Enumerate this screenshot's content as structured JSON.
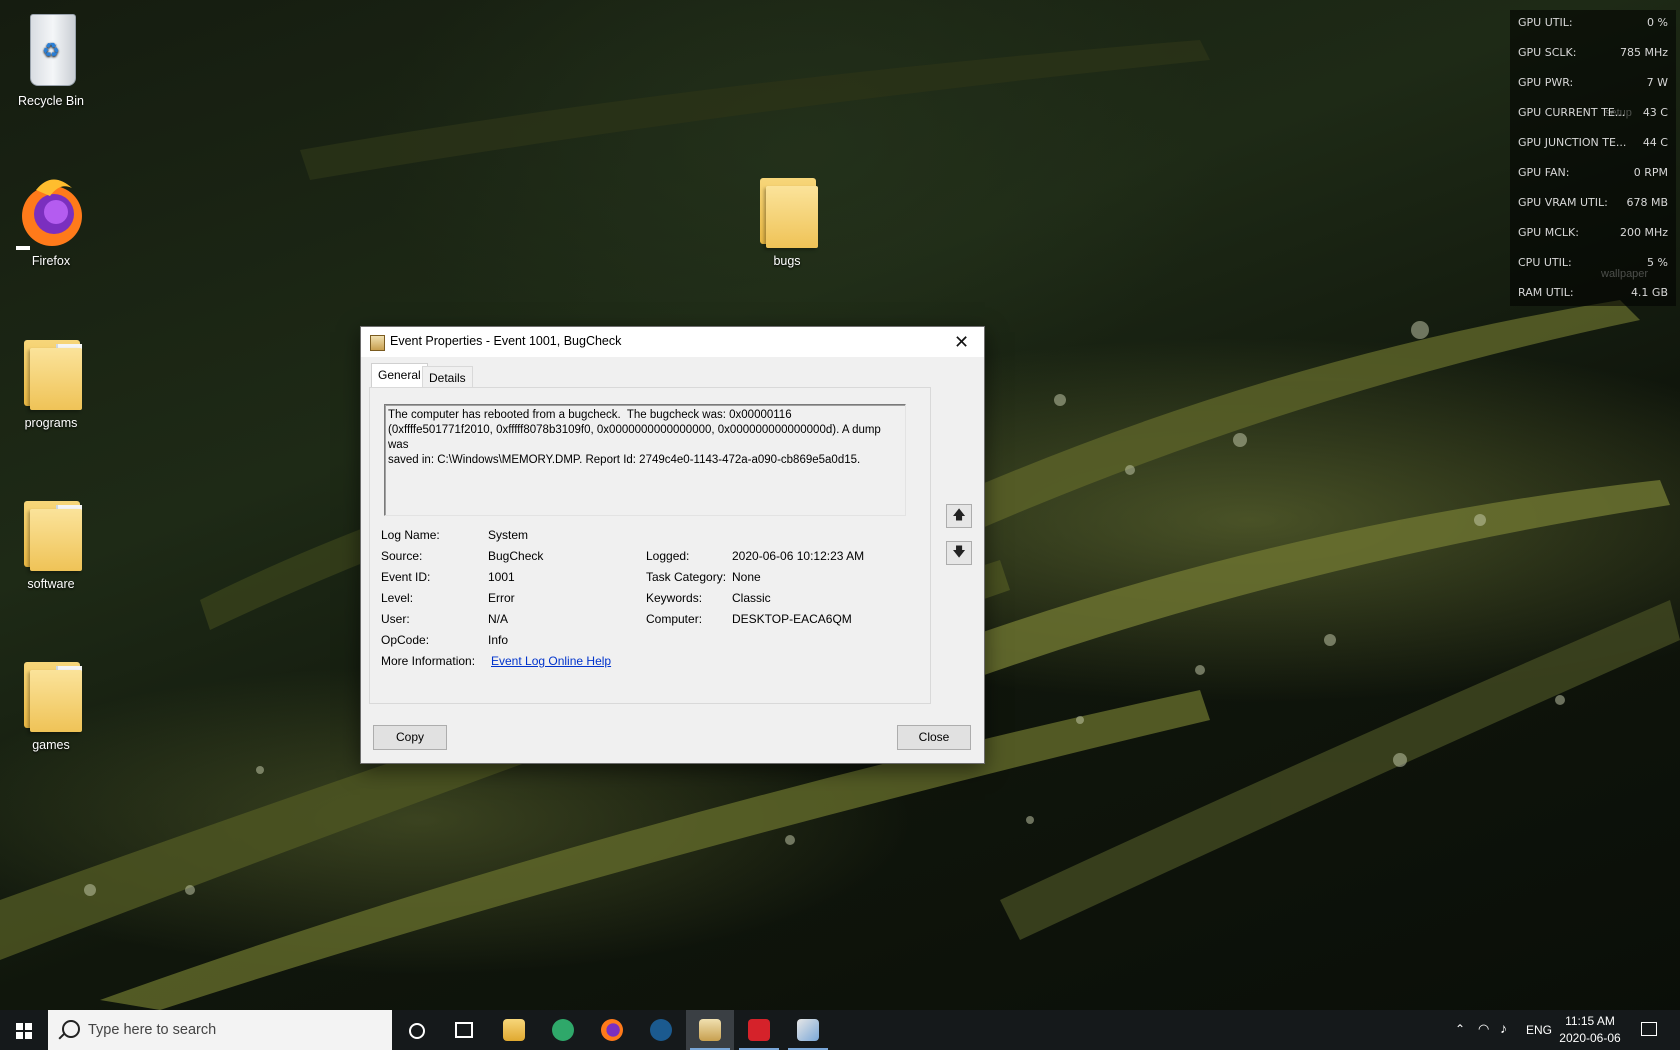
{
  "desktop": {
    "icons": [
      {
        "label": "Recycle Bin"
      },
      {
        "label": "Firefox"
      },
      {
        "label": "programs"
      },
      {
        "label": "software"
      },
      {
        "label": "games"
      },
      {
        "label": "bugs"
      }
    ],
    "overlay_ghost_labels": {
      "setup": "setup",
      "wallpaper": "wallpaper"
    }
  },
  "gpu_overlay": {
    "rows": [
      {
        "label": "GPU UTIL:",
        "value": "0 %"
      },
      {
        "label": "GPU SCLK:",
        "value": "785 MHz"
      },
      {
        "label": "GPU PWR:",
        "value": "7 W"
      },
      {
        "label": "GPU CURRENT TE...",
        "value": "43 C"
      },
      {
        "label": "GPU JUNCTION TE...",
        "value": "44 C"
      },
      {
        "label": "GPU FAN:",
        "value": "0 RPM"
      },
      {
        "label": "GPU VRAM UTIL:",
        "value": "678 MB"
      },
      {
        "label": "GPU MCLK:",
        "value": "200 MHz"
      },
      {
        "label": "CPU UTIL:",
        "value": "5 %"
      },
      {
        "label": "RAM UTIL:",
        "value": "4.1 GB"
      }
    ]
  },
  "dialog": {
    "title": "Event Properties - Event 1001, BugCheck",
    "close_glyph": "✕",
    "tabs": [
      {
        "label": "General"
      },
      {
        "label": "Details"
      }
    ],
    "description": "The computer has rebooted from a bugcheck.  The bugcheck was: 0x00000116\n(0xffffe501771f2010, 0xfffff8078b3109f0, 0x0000000000000000, 0x000000000000000d). A dump was\nsaved in: C:\\Windows\\MEMORY.DMP. Report Id: 2749c4e0-1143-472a-a090-cb869e5a0d15.",
    "fields": {
      "log_name_label": "Log Name:",
      "log_name": "System",
      "source_label": "Source:",
      "source": "BugCheck",
      "event_id_label": "Event ID:",
      "event_id": "1001",
      "level_label": "Level:",
      "level": "Error",
      "user_label": "User:",
      "user": "N/A",
      "opcode_label": "OpCode:",
      "opcode": "Info",
      "more_info_label": "More Information:",
      "more_info_link": "Event Log Online Help",
      "logged_label": "Logged:",
      "logged": "2020-06-06 10:12:23 AM",
      "task_category_label": "Task Category:",
      "task_category": "None",
      "keywords_label": "Keywords:",
      "keywords": "Classic",
      "computer_label": "Computer:",
      "computer": "DESKTOP-EACA6QM"
    },
    "up_arrow": "🡅",
    "down_arrow": "🡇",
    "copy_button": "Copy",
    "close_button": "Close"
  },
  "taskbar": {
    "search_placeholder": "Type here to search",
    "language": "ENG",
    "time": "11:15 AM",
    "date": "2020-06-06"
  },
  "colors": {
    "taskbar": "#15191b",
    "link": "#0033cc",
    "active_underline": "#7aa7d8"
  }
}
